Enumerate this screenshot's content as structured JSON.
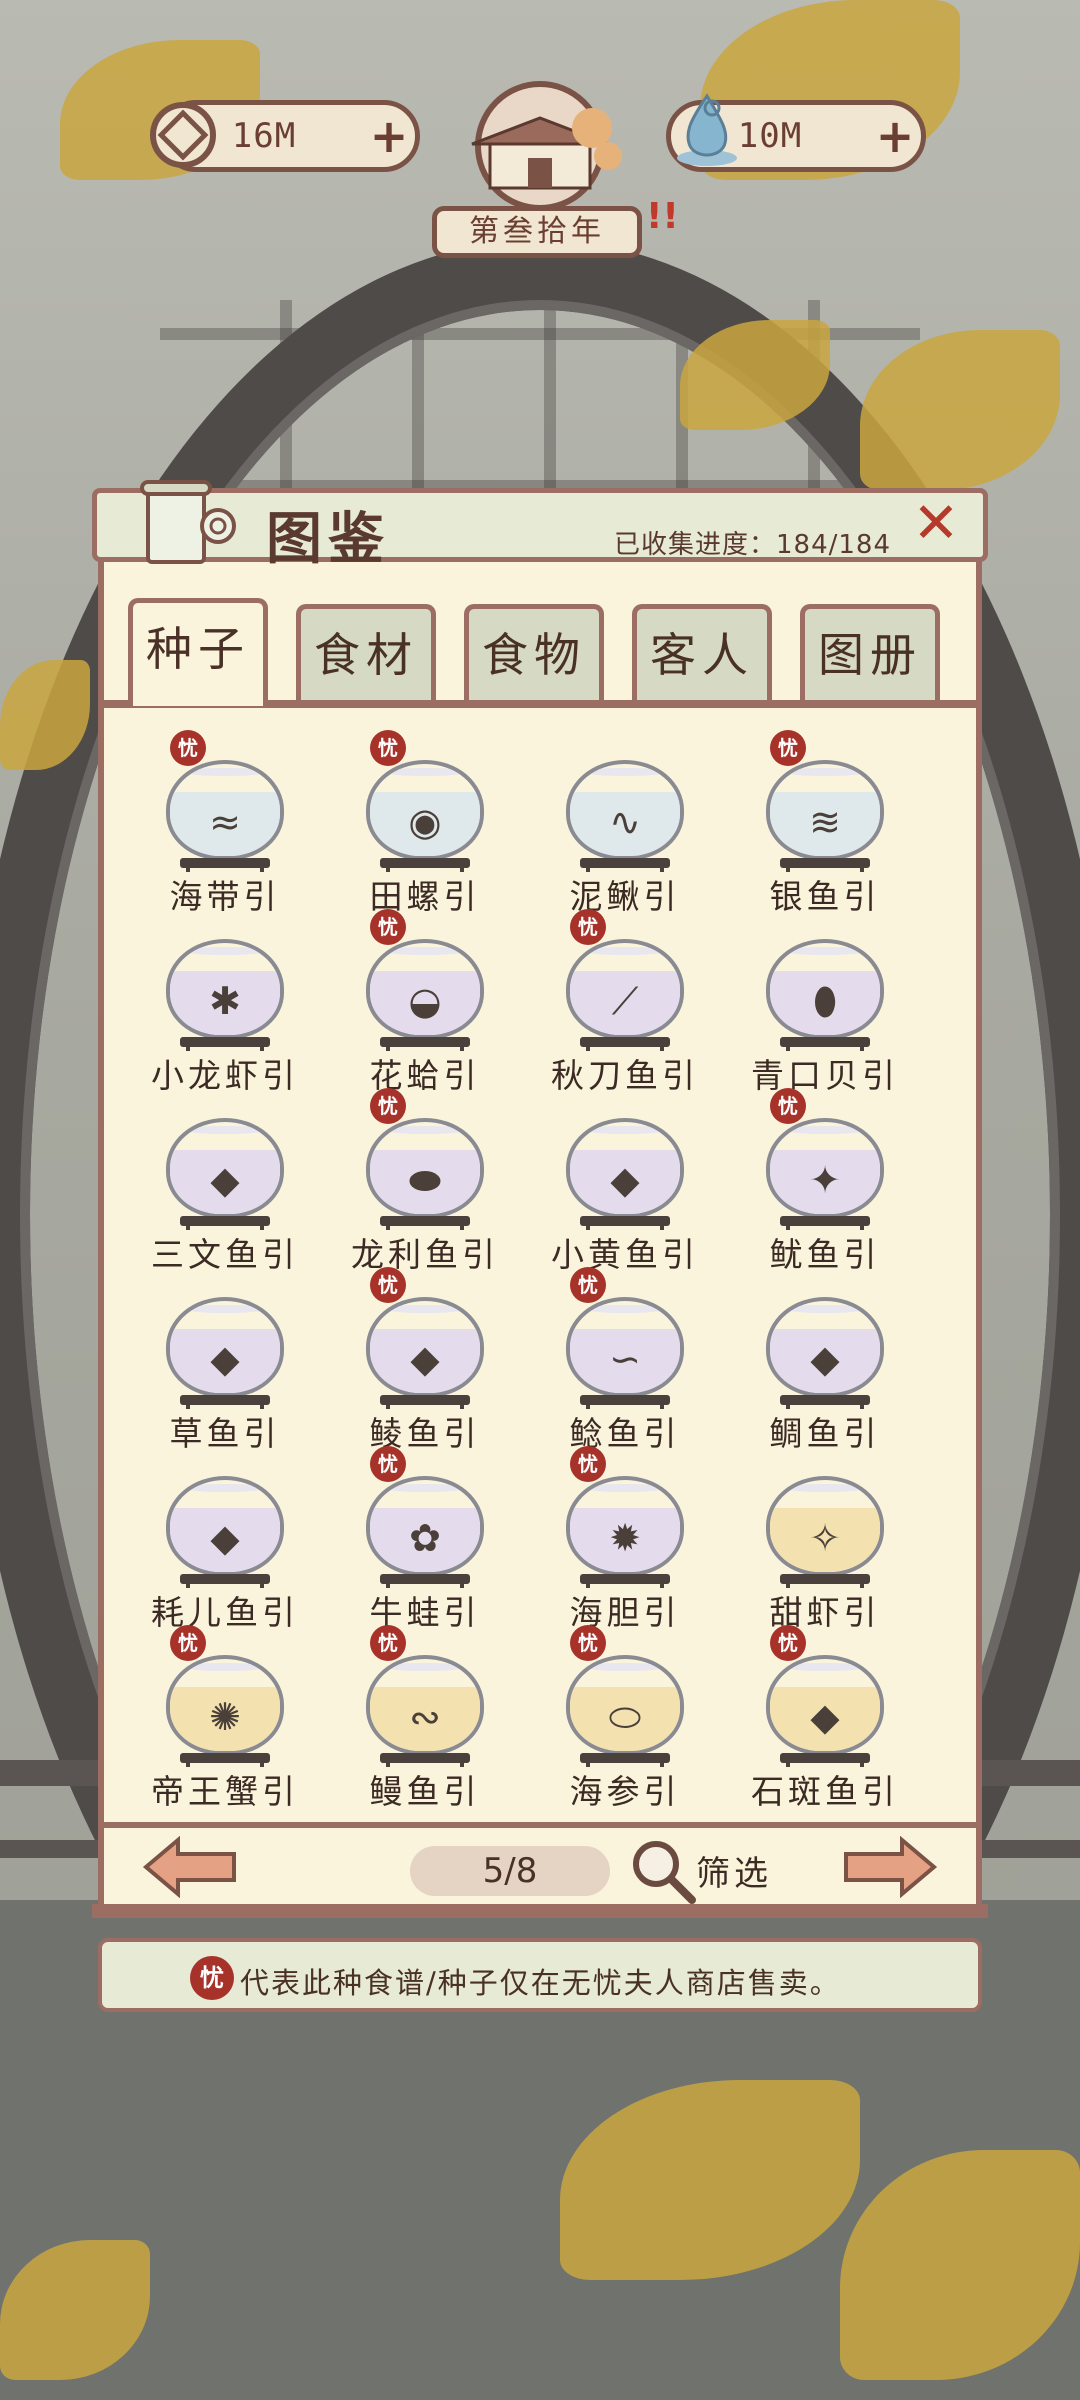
{
  "hud": {
    "coins": "16M",
    "spirit": "10M",
    "plus": "+",
    "year": "第叁拾年"
  },
  "panel": {
    "title": "图鉴",
    "progress": "已收集进度：184/184",
    "close": "✕"
  },
  "tabs": [
    "种子",
    "食材",
    "食物",
    "客人",
    "图册"
  ],
  "active_tab": 0,
  "items": [
    {
      "name": "海带引",
      "badge": true,
      "icon": "seaweed-icon",
      "water": "#dfe8ea"
    },
    {
      "name": "田螺引",
      "badge": true,
      "icon": "snail-icon",
      "water": "#dfe8ea"
    },
    {
      "name": "泥鳅引",
      "badge": false,
      "icon": "loach-icon",
      "water": "#dfe8ea"
    },
    {
      "name": "银鱼引",
      "badge": true,
      "icon": "whitebait-icon",
      "water": "#dfe8ea"
    },
    {
      "name": "小龙虾引",
      "badge": false,
      "icon": "crayfish-icon",
      "water": "#e4dcec"
    },
    {
      "name": "花蛤引",
      "badge": true,
      "icon": "clam-icon",
      "water": "#e4dcec"
    },
    {
      "name": "秋刀鱼引",
      "badge": true,
      "icon": "saury-icon",
      "water": "#e4dcec"
    },
    {
      "name": "青口贝引",
      "badge": false,
      "icon": "mussel-icon",
      "water": "#e4dcec"
    },
    {
      "name": "三文鱼引",
      "badge": false,
      "icon": "salmon-icon",
      "water": "#e4dcec"
    },
    {
      "name": "龙利鱼引",
      "badge": true,
      "icon": "sole-icon",
      "water": "#e4dcec"
    },
    {
      "name": "小黄鱼引",
      "badge": false,
      "icon": "croaker-icon",
      "water": "#e4dcec"
    },
    {
      "name": "鱿鱼引",
      "badge": true,
      "icon": "squid-icon",
      "water": "#e4dcec"
    },
    {
      "name": "草鱼引",
      "badge": false,
      "icon": "grass-carp-icon",
      "water": "#e4dcec"
    },
    {
      "name": "鲮鱼引",
      "badge": true,
      "icon": "dace-icon",
      "water": "#e4dcec"
    },
    {
      "name": "鲶鱼引",
      "badge": true,
      "icon": "catfish-icon",
      "water": "#e4dcec"
    },
    {
      "name": "鲷鱼引",
      "badge": false,
      "icon": "bream-icon",
      "water": "#e4dcec"
    },
    {
      "name": "耗儿鱼引",
      "badge": false,
      "icon": "filefish-icon",
      "water": "#e4dcec"
    },
    {
      "name": "牛蛙引",
      "badge": true,
      "icon": "bullfrog-icon",
      "water": "#e4dcec"
    },
    {
      "name": "海胆引",
      "badge": true,
      "icon": "sea-urchin-icon",
      "water": "#e4dcec"
    },
    {
      "name": "甜虾引",
      "badge": false,
      "icon": "shrimp-icon",
      "water": "#f3e2b0"
    },
    {
      "name": "帝王蟹引",
      "badge": true,
      "icon": "king-crab-icon",
      "water": "#f3e2b0"
    },
    {
      "name": "鳗鱼引",
      "badge": true,
      "icon": "eel-icon",
      "water": "#f3e2b0"
    },
    {
      "name": "海参引",
      "badge": true,
      "icon": "sea-cucumber-icon",
      "water": "#f3e2b0"
    },
    {
      "name": "石斑鱼引",
      "badge": true,
      "icon": "grouper-icon",
      "water": "#f3e2b0"
    }
  ],
  "badge_char": "忧",
  "pager": {
    "page": "5/8",
    "filter": "筛选"
  },
  "note": "代表此种食谱/种子仅在无忧夫人商店售卖。",
  "colors": {
    "border": "#9c6d62",
    "panel": "#faf4dc",
    "badge": "#a7322a",
    "arrow": "#e4a184"
  }
}
